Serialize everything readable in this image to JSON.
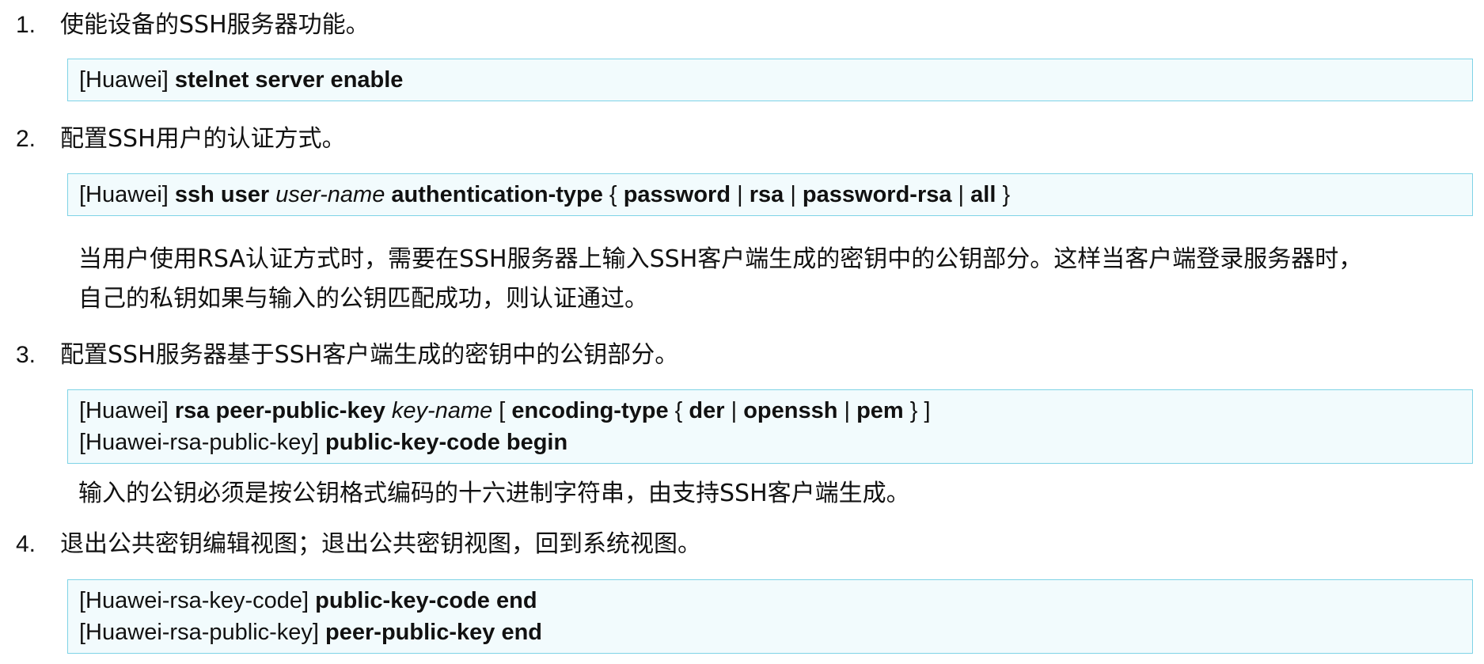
{
  "steps": [
    {
      "number": "1.",
      "title": "使能设备的SSH服务器功能。",
      "commands": [
        [
          {
            "text": "[Huawei] ",
            "style": "normal"
          },
          {
            "text": "stelnet server enable",
            "style": "bold"
          }
        ]
      ]
    },
    {
      "number": "2.",
      "title": "配置SSH用户的认证方式。",
      "commands": [
        [
          {
            "text": "[Huawei] ",
            "style": "normal"
          },
          {
            "text": "ssh user",
            "style": "bold"
          },
          {
            "text": " ",
            "style": "normal"
          },
          {
            "text": "user-name",
            "style": "italic"
          },
          {
            "text": " ",
            "style": "normal"
          },
          {
            "text": "authentication-type",
            "style": "bold"
          },
          {
            "text": " { ",
            "style": "normal"
          },
          {
            "text": "password",
            "style": "bold"
          },
          {
            "text": " | ",
            "style": "normal"
          },
          {
            "text": "rsa",
            "style": "bold"
          },
          {
            "text": " | ",
            "style": "normal"
          },
          {
            "text": "password-rsa",
            "style": "bold"
          },
          {
            "text": " | ",
            "style": "normal"
          },
          {
            "text": "all",
            "style": "bold"
          },
          {
            "text": " }",
            "style": "normal"
          }
        ]
      ],
      "note_lines": [
        "当用户使用RSA认证方式时，需要在SSH服务器上输入SSH客户端生成的密钥中的公钥部分。这样当客户端登录服务器时，",
        "自己的私钥如果与输入的公钥匹配成功，则认证通过。"
      ]
    },
    {
      "number": "3.",
      "title": "配置SSH服务器基于SSH客户端生成的密钥中的公钥部分。",
      "commands": [
        [
          {
            "text": "[Huawei] ",
            "style": "normal"
          },
          {
            "text": "rsa peer-public-key",
            "style": "bold"
          },
          {
            "text": " ",
            "style": "normal"
          },
          {
            "text": "key-name",
            "style": "italic"
          },
          {
            "text": " [ ",
            "style": "normal"
          },
          {
            "text": "encoding-type",
            "style": "bold"
          },
          {
            "text": " { ",
            "style": "normal"
          },
          {
            "text": "der",
            "style": "bold"
          },
          {
            "text": " | ",
            "style": "normal"
          },
          {
            "text": "openssh",
            "style": "bold"
          },
          {
            "text": " | ",
            "style": "normal"
          },
          {
            "text": "pem",
            "style": "bold"
          },
          {
            "text": " } ]",
            "style": "normal"
          }
        ],
        [
          {
            "text": "[Huawei-rsa-public-key] ",
            "style": "normal"
          },
          {
            "text": "public-key-code begin",
            "style": "bold"
          }
        ]
      ],
      "note_lines": [
        "输入的公钥必须是按公钥格式编码的十六进制字符串，由支持SSH客户端生成。"
      ]
    },
    {
      "number": "4.",
      "title": "退出公共密钥编辑视图；退出公共密钥视图，回到系统视图。",
      "commands": [
        [
          {
            "text": "[Huawei-rsa-key-code] ",
            "style": "normal"
          },
          {
            "text": "public-key-code end",
            "style": "bold"
          }
        ],
        [
          {
            "text": "[Huawei-rsa-public-key] ",
            "style": "normal"
          },
          {
            "text": "peer-public-key end",
            "style": "bold"
          }
        ]
      ]
    }
  ]
}
